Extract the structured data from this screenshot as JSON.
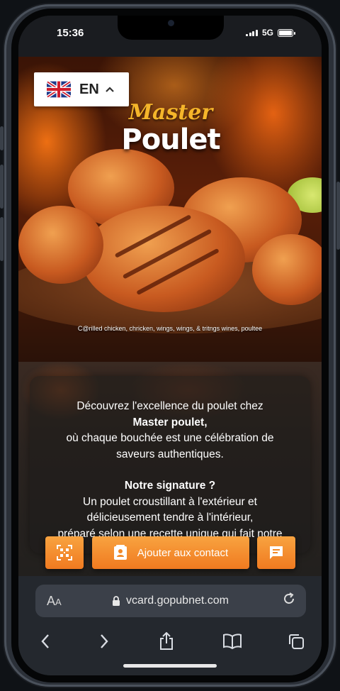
{
  "status": {
    "time": "15:36",
    "network": "5G"
  },
  "language": {
    "code": "EN"
  },
  "hero": {
    "brand_script": "Master",
    "brand_main": "Poulet",
    "caption": "C@rilled chicken, chricken, wings, wings, & tritngs wines, poultee"
  },
  "intro": {
    "line1": "Découvrez l'excellence du poulet chez",
    "line2": "Master poulet,",
    "line3": "où chaque bouchée est une célébration de",
    "line4": "saveurs authentiques.",
    "line5": "Notre signature ?",
    "line6": "Un poulet croustillant à l'extérieur et",
    "line7": "délicieusement tendre à l'intérieur,",
    "line8": "préparé selon une recette unique qui fait notre"
  },
  "actions": {
    "add_contact_label": "Ajouter aux contact"
  },
  "browser": {
    "aa_big": "A",
    "aa_small": "A",
    "url": "vcard.gopubnet.com"
  },
  "colors": {
    "accent": "#f5902e",
    "brand_gold": "#f5b52a"
  }
}
